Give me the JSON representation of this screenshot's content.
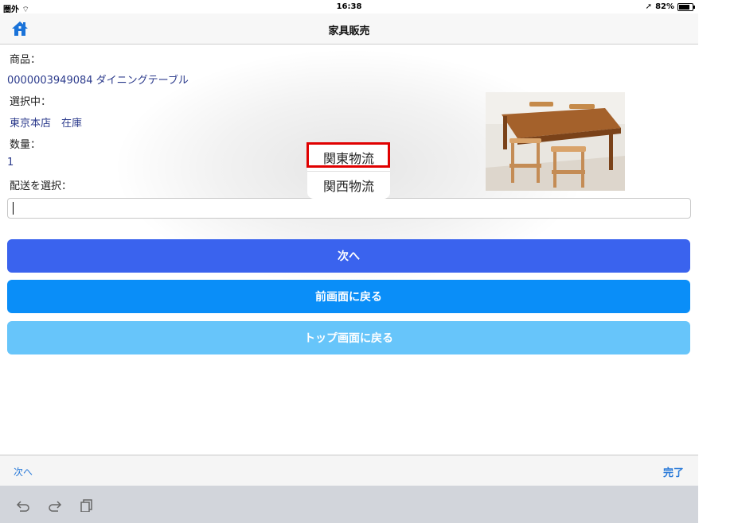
{
  "status": {
    "carrier": "圏外",
    "time": "16:38",
    "battery": "82%"
  },
  "nav": {
    "title": "家具販売",
    "home_icon": "home-icon"
  },
  "product": {
    "product_label": "商品：",
    "product_value": "0000003949084 ダイニングテーブル",
    "selected_label": "選択中：",
    "selected_value": "東京本店　在庫",
    "quantity_label": "数量：",
    "quantity_value": "1",
    "delivery_label": "配送を選択："
  },
  "delivery_input": {
    "value": ""
  },
  "picker": {
    "options": [
      "関東物流",
      "関西物流"
    ],
    "highlighted": "関東物流"
  },
  "buttons": {
    "next": "次へ",
    "back": "前画面に戻る",
    "top": "トップ画面に戻る"
  },
  "accessory": {
    "next": "次へ",
    "done": "完了"
  },
  "colors": {
    "primary": "#3a63ee",
    "secondary": "#0a8ef8",
    "tertiary": "#67c5fa",
    "highlight": "#e00000"
  }
}
